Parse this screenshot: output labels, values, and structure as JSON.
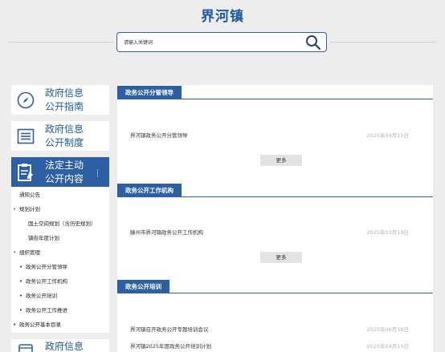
{
  "site": {
    "title": "界河镇"
  },
  "search": {
    "placeholder": "请输入关键词",
    "value": ""
  },
  "sidebar": {
    "cards": [
      {
        "label": "政府信息公开指南",
        "line1": "政府信息",
        "line2": "公开指南",
        "icon": "compass-icon"
      },
      {
        "label": "政府信息公开制度",
        "line1": "政府信息",
        "line2": "公开制度",
        "icon": "list-icon"
      },
      {
        "label": "法定主动公开内容",
        "line1": "法定主动",
        "line2": "公开内容",
        "icon": "document-edit-icon",
        "active": true
      }
    ],
    "tree": [
      {
        "label": "通知公告",
        "level": 0
      },
      {
        "label": "规划计划",
        "level": 0,
        "bullet": true
      },
      {
        "label": "国土空间规划（含历史规划）",
        "level": 2
      },
      {
        "label": "镇街年度计划",
        "level": 2
      },
      {
        "label": "组织管理",
        "level": 0,
        "bullet": true
      },
      {
        "label": "政务公开分管领导",
        "level": 1,
        "bullet": true
      },
      {
        "label": "政务公开工作机构",
        "level": 1,
        "bullet": true
      },
      {
        "label": "政务公开培训",
        "level": 1,
        "bullet": true
      },
      {
        "label": "政务公开工作推进",
        "level": 1,
        "bullet": true
      },
      {
        "label": "政务公开基本目录",
        "level": 0,
        "bullet": true
      }
    ],
    "bottom_card": {
      "line1": "政府信息",
      "icon": "bus-icon"
    }
  },
  "sections": [
    {
      "title": "政务公开分管领导",
      "items": [
        {
          "text": "界河镇政务公开分管领导",
          "date": "2025年04月15日"
        }
      ],
      "more": "更多"
    },
    {
      "title": "政务公开工作机构",
      "items": [
        {
          "text": "滕州市界河镇政务公开工作机构",
          "date": "2025年03月19日"
        }
      ],
      "more": "更多"
    },
    {
      "title": "政务公开培训",
      "items": [
        {
          "text": "界河镇召开政务公开专题培训会议",
          "date": "2025年06月16日"
        },
        {
          "text": "界河镇2025年度政务公开培训计划",
          "date": "2025年04月15日"
        }
      ]
    }
  ],
  "colors": {
    "accent": "#2c5fa4",
    "title": "#1e5aa0",
    "background": "#ededed",
    "date": "#b0b0b0"
  }
}
